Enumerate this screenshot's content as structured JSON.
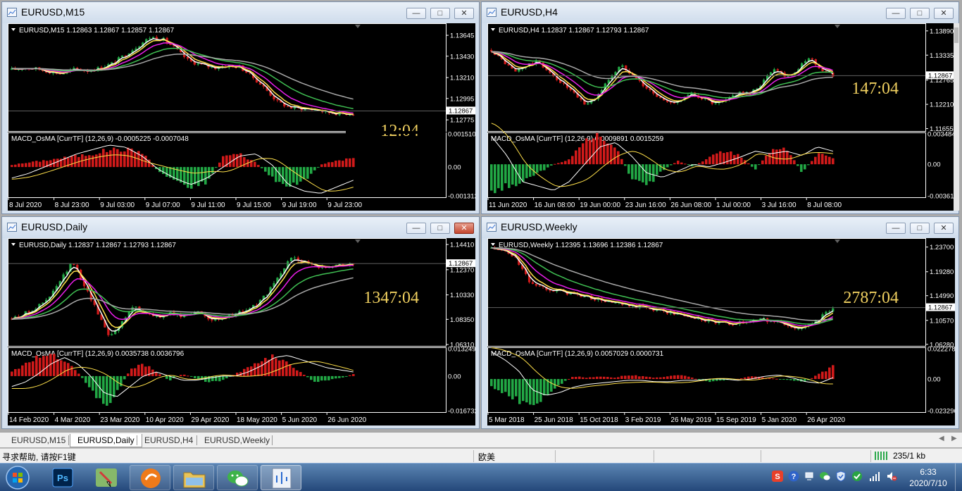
{
  "colors": {
    "bull": "#22a845",
    "bear": "#d11a1a",
    "yellow": "#ffe04a",
    "magenta": "#e91ee9",
    "green_ma": "#3fbf52",
    "gray_ma": "#a8a8a8",
    "white": "#ffffff",
    "timer": "#f0d060",
    "axis_text": "#ffffff",
    "grid_line": "#606060"
  },
  "windows": [
    {
      "id": "m15",
      "title": "EURUSD,M15",
      "active": false,
      "header": "EURUSD,M15  1.12863 1.12867 1.12857 1.12867",
      "price_ticks": [
        "1.13645",
        "1.13430",
        "1.13210",
        "1.12995",
        "1.12775"
      ],
      "current_price": "1.12867",
      "price_range": [
        1.1266,
        1.1374
      ],
      "timer": "12:04",
      "macd_header": "MACD_OsMA [CurrTF] (12,26,9) -0.0005225 -0.0007048",
      "macd_ticks": [
        "0.0015103",
        "0.00",
        "-0.001312"
      ],
      "time_ticks": [
        "8 Jul 2020",
        "8 Jul 23:00",
        "9 Jul 03:00",
        "9 Jul 07:00",
        "9 Jul 11:00",
        "9 Jul 15:00",
        "9 Jul 19:00",
        "9 Jul 23:00"
      ],
      "price_path": [
        1.1329,
        1.1331,
        1.133,
        1.1327,
        1.1325,
        1.133,
        1.1328,
        1.1331,
        1.1336,
        1.1345,
        1.1354,
        1.1363,
        1.136,
        1.135,
        1.1338,
        1.1334,
        1.1331,
        1.1333,
        1.1332,
        1.1322,
        1.131,
        1.1296,
        1.129,
        1.1289,
        1.1288,
        1.1285,
        1.1284,
        1.1284
      ],
      "hist": [
        0.0001,
        0.0002,
        0.0003,
        0.0004,
        0.0005,
        0.0006,
        0.0008,
        0.0008,
        0.0007,
        -0.0002,
        -0.0006,
        -0.0009,
        -0.0007,
        0.0005,
        0.0006,
        0.0002,
        -0.0005,
        -0.0009,
        -0.0006,
        0.0001,
        0.0003,
        0.0004
      ],
      "sig": [
        -0.0005,
        -0.0003,
        0.0,
        0.0003,
        0.0006,
        0.0008,
        0.001,
        0.0009,
        0.0005,
        -0.0001,
        -0.0005,
        -0.0008,
        -0.0005,
        0.0,
        0.0005,
        0.0006,
        0.0001,
        -0.0008,
        -0.0011,
        -0.0012,
        -0.0009,
        -0.0006
      ]
    },
    {
      "id": "h4",
      "title": "EURUSD,H4",
      "active": false,
      "header": "EURUSD,H4  1.12837 1.12867 1.12793 1.12867",
      "price_ticks": [
        "1.13890",
        "1.13335",
        "1.12765",
        "1.12210",
        "1.11655"
      ],
      "current_price": "1.12867",
      "price_range": [
        1.116,
        1.14
      ],
      "timer": "147:04",
      "macd_header": "MACD_OsMA [CurrTF] (12,26,9) 0.0009891 0.0015259",
      "macd_ticks": [
        "0.0034847",
        "0.00",
        "-0.003619"
      ],
      "time_ticks": [
        "11 Jun 2020",
        "16 Jun 08:00",
        "19 Jun 00:00",
        "23 Jun 16:00",
        "26 Jun 08:00",
        "1 Jul 00:00",
        "3 Jul 16:00",
        "8 Jul 08:00"
      ],
      "price_path": [
        1.1345,
        1.132,
        1.1295,
        1.131,
        1.132,
        1.129,
        1.127,
        1.1245,
        1.122,
        1.124,
        1.128,
        1.131,
        1.129,
        1.1262,
        1.124,
        1.1225,
        1.123,
        1.1245,
        1.1235,
        1.122,
        1.123,
        1.125,
        1.1245,
        1.127,
        1.1305,
        1.1285,
        1.13,
        1.133,
        1.13,
        1.1287
      ],
      "hist": [
        -0.003,
        -0.0025,
        -0.002,
        -0.001,
        0.0,
        0.0005,
        0.003,
        0.0033,
        0.002,
        -0.0015,
        -0.0025,
        -0.0008,
        0.0004,
        -0.0003,
        0.0008,
        0.0015,
        0.001,
        -0.0006,
        0.0016,
        0.0019,
        -0.001,
        0.0012,
        0.0008
      ],
      "sig": [
        0.0032,
        0.001,
        -0.002,
        -0.0025,
        -0.003,
        -0.002,
        0.0,
        0.002,
        0.0025,
        0.001,
        -0.001,
        -0.0015,
        -0.0008,
        0.0,
        -0.0003,
        0.0002,
        0.0008,
        0.0015,
        0.0012,
        0.0015,
        0.001,
        0.002,
        0.0015
      ]
    },
    {
      "id": "daily",
      "title": "EURUSD,Daily",
      "active": true,
      "header": "EURUSD,Daily  1.12837 1.12867 1.12793 1.12867",
      "price_ticks": [
        "1.14410",
        "1.12370",
        "1.10330",
        "1.08350",
        "1.06310"
      ],
      "current_price": "1.12867",
      "price_range": [
        1.062,
        1.147
      ],
      "timer": "1347:04",
      "macd_header": "MACD_OsMA [CurrTF] (12,26,9) 0.0035738 0.0036796",
      "macd_ticks": [
        "0.0132494",
        "0.00",
        "-0.016732"
      ],
      "time_ticks": [
        "14 Feb 2020",
        "4 Mar 2020",
        "23 Mar 2020",
        "10 Apr 2020",
        "29 Apr 2020",
        "18 May 2020",
        "5 Jun 2020",
        "26 Jun 2020"
      ],
      "price_path": [
        1.084,
        1.088,
        1.093,
        1.1,
        1.115,
        1.13,
        1.11,
        1.09,
        1.07,
        1.08,
        1.095,
        1.088,
        1.085,
        1.088,
        1.086,
        1.09,
        1.085,
        1.082,
        1.087,
        1.09,
        1.095,
        1.105,
        1.12,
        1.135,
        1.13,
        1.125,
        1.127,
        1.128,
        1.1287
      ],
      "hist": [
        0.002,
        0.006,
        0.009,
        0.011,
        0.008,
        0.002,
        -0.006,
        -0.015,
        -0.008,
        0.003,
        0.006,
        0.002,
        -0.002,
        0.001,
        -0.001,
        -0.003,
        -0.002,
        0.001,
        0.004,
        0.008,
        0.01,
        0.006,
        0.002,
        -0.003,
        -0.002,
        -0.001,
        0.001
      ],
      "sig": [
        -0.005,
        -0.003,
        0.001,
        0.006,
        0.009,
        0.006,
        0.0,
        -0.008,
        -0.01,
        -0.005,
        0.0,
        0.002,
        0.0,
        -0.002,
        -0.002,
        -0.001,
        0.0,
        0.0,
        0.002,
        0.005,
        0.009,
        0.01,
        0.008,
        0.006,
        0.004,
        0.003,
        0.002
      ]
    },
    {
      "id": "weekly",
      "title": "EURUSD,Weekly",
      "active": false,
      "header": "EURUSD,Weekly  1.12395 1.13696 1.12386 1.12867",
      "price_ticks": [
        "1.23700",
        "1.19280",
        "1.14990",
        "1.10570",
        "1.06280"
      ],
      "current_price": "1.12867",
      "price_range": [
        1.06,
        1.248
      ],
      "timer": "2787:04",
      "macd_header": "MACD_OsMA [CurrTF] (12,26,9) 0.0057029 0.0000731",
      "macd_ticks": [
        "0.0222782",
        "0.00",
        "-0.023296"
      ],
      "time_ticks": [
        "5 Mar 2018",
        "25 Jun 2018",
        "15 Oct 2018",
        "3 Feb 2019",
        "26 May 2019",
        "15 Sep 2019",
        "5 Jan 2020",
        "26 Apr 2020"
      ],
      "price_path": [
        1.235,
        1.23,
        1.215,
        1.175,
        1.165,
        1.16,
        1.155,
        1.15,
        1.145,
        1.14,
        1.135,
        1.13,
        1.13,
        1.125,
        1.12,
        1.115,
        1.11,
        1.105,
        1.1,
        1.1,
        1.102,
        1.108,
        1.105,
        1.1,
        1.09,
        1.095,
        1.11,
        1.1287
      ],
      "hist": [
        -0.006,
        -0.01,
        -0.016,
        -0.019,
        -0.012,
        -0.004,
        0.002,
        0.001,
        0.002,
        0.001,
        0.003,
        0.002,
        0.001,
        0.002,
        0.003,
        0.0,
        -0.002,
        -0.001,
        0.0,
        0.002,
        0.001,
        0.0,
        -0.001,
        -0.002,
        0.004,
        0.009
      ],
      "sig": [
        0.02,
        0.014,
        0.006,
        -0.008,
        -0.012,
        -0.01,
        -0.006,
        -0.004,
        -0.003,
        -0.002,
        -0.001,
        -0.001,
        -0.002,
        -0.002,
        -0.001,
        -0.001,
        0.0,
        0.0,
        -0.001,
        0.0,
        0.002,
        0.003,
        0.001,
        -0.002,
        -0.003,
        0.001
      ]
    }
  ],
  "tabs": [
    {
      "label": "EURUSD,M15",
      "active": false
    },
    {
      "label": "EURUSD,Daily",
      "active": true
    },
    {
      "label": "EURUSD,H4",
      "active": false
    },
    {
      "label": "EURUSD,Weekly",
      "active": false
    }
  ],
  "status": {
    "help": "寻求帮助, 请按F1键",
    "profile": "欧美",
    "traffic": "235/1 kb"
  },
  "taskbar": {
    "apps": [
      {
        "name": "start-orb",
        "color": "#1f6fc4"
      },
      {
        "name": "photoshop",
        "color": "#00234a"
      },
      {
        "name": "paint-app",
        "color": "#86b86a"
      },
      {
        "name": "media-app",
        "color": "#ef7a1a"
      },
      {
        "name": "file-explorer",
        "color": "#e8c45a"
      },
      {
        "name": "wechat",
        "color": "#3eb34a"
      },
      {
        "name": "metatrader",
        "color": "#cfd8e6"
      }
    ],
    "time": "6:33",
    "date": "2020/7/10"
  }
}
